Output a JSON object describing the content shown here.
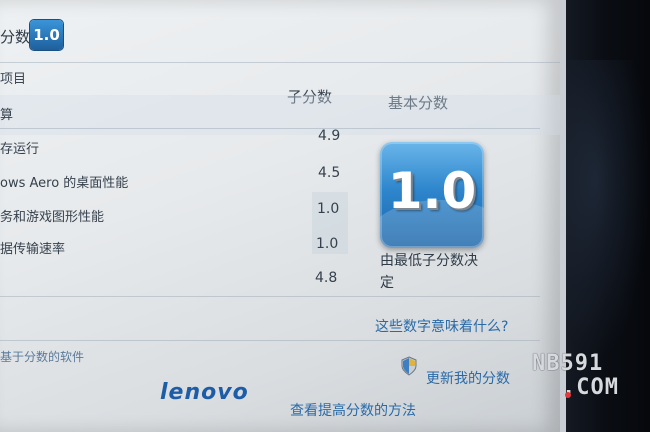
{
  "header": {
    "title": "分数",
    "badge": "1.0"
  },
  "table": {
    "col_component": "项目",
    "col_subscore": "子分数",
    "col_base": "基本分数",
    "rows": [
      {
        "label": "算",
        "score": ""
      },
      {
        "label": "存运行",
        "score": "4.9"
      },
      {
        "label": "ows Aero 的桌面性能",
        "score": "4.5"
      },
      {
        "label": "务和游戏图形性能",
        "score": "1.0"
      },
      {
        "label": "据传输速率",
        "score": "1.0"
      },
      {
        "label": "",
        "score": "4.8"
      }
    ]
  },
  "base_score": {
    "value": "1.0",
    "note": "由最低子分数决定"
  },
  "links": {
    "meaning": "这些数字意味着什么?",
    "update": "更新我的分数",
    "left_partial": "基于分数的软件",
    "improve": "查看提高分数的方法"
  },
  "brand": {
    "logo": "lenovo"
  },
  "watermark": {
    "line1": "NB591",
    "line2": ".COM"
  },
  "colors": {
    "badge_blue": "#2e86cc",
    "link_blue": "#2a6aa8",
    "lenovo_blue": "#1d5ca6",
    "watermark_dot": "#e5383b"
  }
}
